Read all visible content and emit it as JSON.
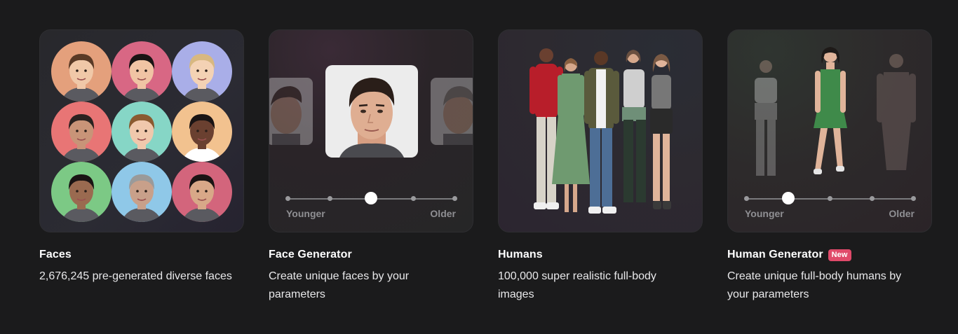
{
  "cards": [
    {
      "title": "Faces",
      "description": "2,676,245 pre-generated diverse faces",
      "image": "faces-grid"
    },
    {
      "title": "Face Generator",
      "description": "Create unique faces by your parameters",
      "image": "face-age-slider",
      "slider": {
        "left_label": "Younger",
        "right_label": "Older",
        "value": 0.5
      }
    },
    {
      "title": "Humans",
      "description": "100,000 super realistic full-body images",
      "image": "full-body-group"
    },
    {
      "title": "Human Generator",
      "badge": "New",
      "description": "Create unique full-body humans by your parameters",
      "image": "body-age-slider",
      "slider": {
        "left_label": "Younger",
        "right_label": "Older",
        "value": 0.25
      }
    }
  ],
  "colors": {
    "background": "#1b1b1c",
    "badge": "#e04a6a",
    "slider_track": "#7a7a7d",
    "face_circles": [
      "#e4a07c",
      "#d86784",
      "#a9aee8",
      "#e87575",
      "#86d6c6",
      "#f2c28f",
      "#7cc985",
      "#8fc8e8",
      "#d3657c"
    ]
  }
}
